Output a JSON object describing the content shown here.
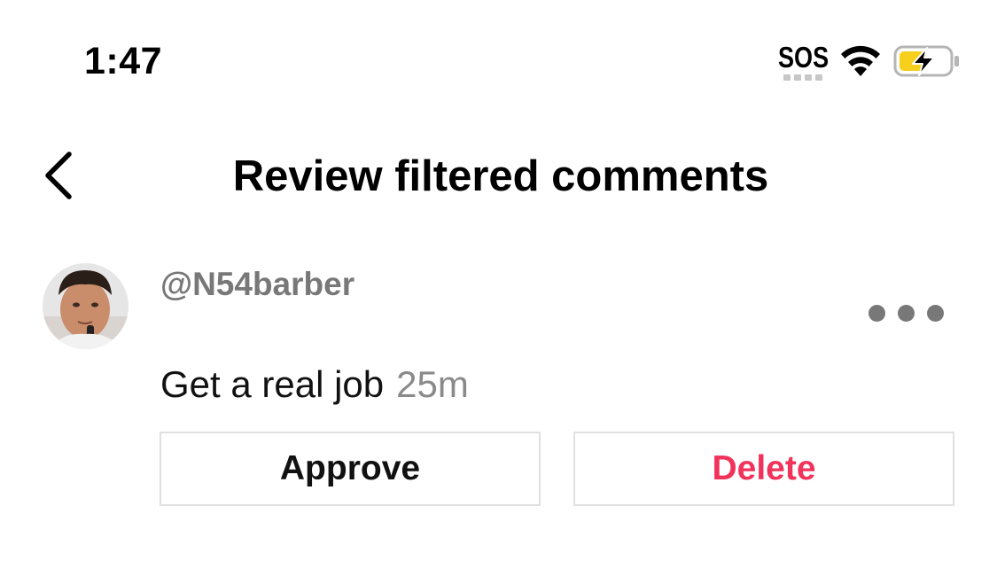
{
  "status_bar": {
    "time": "1:47",
    "sos": "SOS",
    "icons": [
      "wifi-icon",
      "battery-charging-icon"
    ],
    "battery_color": "#f7cf1d"
  },
  "header": {
    "title": "Review filtered comments",
    "back_icon": "chevron-left-icon"
  },
  "comment": {
    "username": "@N54barber",
    "text": "Get a real job",
    "time": "25m",
    "more_icon": "more-horizontal-icon"
  },
  "actions": {
    "approve_label": "Approve",
    "delete_label": "Delete",
    "delete_color": "#f1325a"
  }
}
